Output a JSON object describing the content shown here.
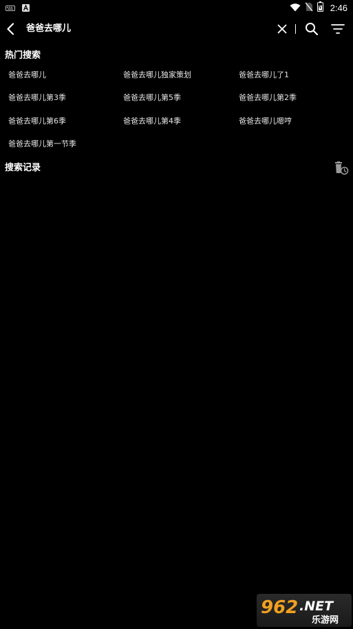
{
  "status_bar": {
    "time": "2:46",
    "icons": [
      "keyboard-icon",
      "a-badge-icon",
      "wifi-icon",
      "no-sim-icon",
      "battery-icon"
    ]
  },
  "toolbar": {
    "search_value": "爸爸去哪儿",
    "icons": [
      "back-arrow-icon",
      "close-icon",
      "search-icon",
      "filter-icon"
    ]
  },
  "hot_search": {
    "title": "热门搜索",
    "items": [
      "爸爸去哪儿",
      "爸爸去哪儿独家策划",
      "爸爸去哪儿了1",
      "爸爸去哪儿第3季",
      "爸爸去哪儿第5季",
      "爸爸去哪儿第2季",
      "爸爸去哪儿第6季",
      "爸爸去哪儿第4季",
      "爸爸去哪儿嗯哼",
      "爸爸去哪儿第一节季"
    ]
  },
  "history": {
    "title": "搜索记录",
    "clear_icon": "trash-clock-icon"
  },
  "watermark": {
    "brand": "962.NET",
    "sub": "乐游网",
    "colors": {
      "accent": "#f0a020",
      "text": "#ffffff"
    }
  }
}
